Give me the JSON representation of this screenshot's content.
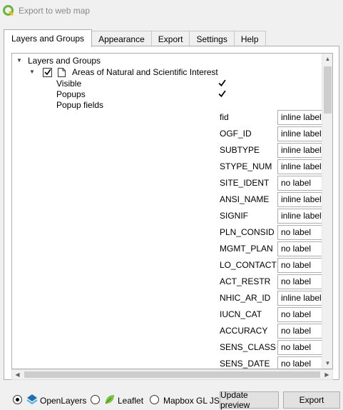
{
  "window": {
    "title": "Export to web map"
  },
  "tabs": [
    "Layers and Groups",
    "Appearance",
    "Export",
    "Settings",
    "Help"
  ],
  "tree": {
    "root_label": "Layers and Groups",
    "layer_label": "Areas of Natural and Scientific Interest",
    "layer_checked": true,
    "visible_label": "Visible",
    "visible_checked": true,
    "popups_label": "Popups",
    "popups_checked": true,
    "popup_fields_label": "Popup fields",
    "fields": [
      {
        "name": "fid",
        "label": "inline label"
      },
      {
        "name": "OGF_ID",
        "label": "inline label"
      },
      {
        "name": "SUBTYPE",
        "label": "inline label"
      },
      {
        "name": "STYPE_NUM",
        "label": "inline label"
      },
      {
        "name": "SITE_IDENT",
        "label": "no label"
      },
      {
        "name": "ANSI_NAME",
        "label": "inline label"
      },
      {
        "name": "SIGNIF",
        "label": "inline label"
      },
      {
        "name": "PLN_CONSID",
        "label": "no label"
      },
      {
        "name": "MGMT_PLAN",
        "label": "no label"
      },
      {
        "name": "LO_CONTACT",
        "label": "no label"
      },
      {
        "name": "ACT_RESTR",
        "label": "no label"
      },
      {
        "name": "NHIC_AR_ID",
        "label": "inline label"
      },
      {
        "name": "IUCN_CAT",
        "label": "no label"
      },
      {
        "name": "ACCURACY",
        "label": "no label"
      },
      {
        "name": "SENS_CLASS",
        "label": "no label"
      },
      {
        "name": "SENS_DATE",
        "label": "no label"
      }
    ]
  },
  "bottom": {
    "openlayers_label": "OpenLayers",
    "leaflet_label": "Leaflet",
    "mapbox_label": "Mapbox GL JS",
    "selected_map": "OpenLayers",
    "update_preview_label": "Update preview",
    "export_label": "Export"
  },
  "colors": {
    "qgis_green": "#6cb33f",
    "openlayers_blue": "#1f6fb5",
    "leaflet_green": "#7bc242"
  }
}
